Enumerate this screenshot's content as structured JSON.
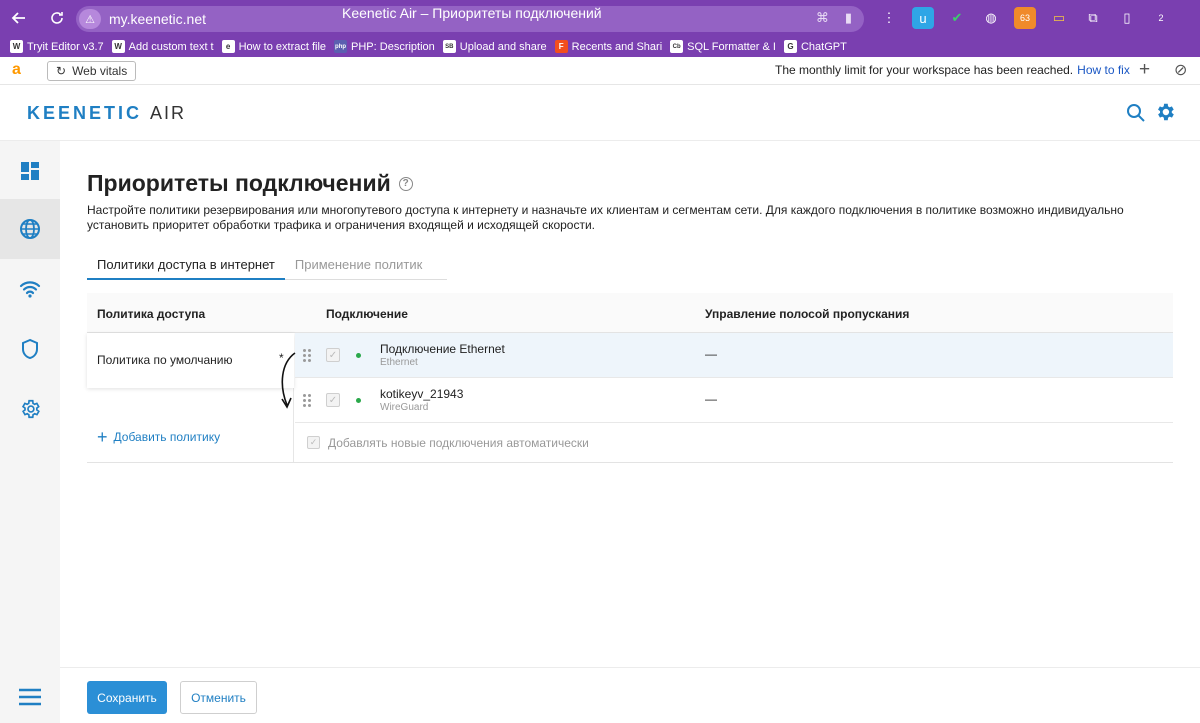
{
  "browser": {
    "url": "my.keenetic.net",
    "tab_title": "Keenetic Air – Приоритеты подключений",
    "back_icon": "arrow-left-icon",
    "reload_icon": "reload-icon",
    "ext_badges": {
      "calendar_count": "63",
      "downloads_count": "2"
    },
    "bookmarks": [
      {
        "label": "Tryit Editor v3.7",
        "icon": "W"
      },
      {
        "label": "Add custom text t",
        "icon": "W"
      },
      {
        "label": "How to extract file",
        "icon": "e"
      },
      {
        "label": "PHP: Description",
        "icon": "php"
      },
      {
        "label": "Upload and share",
        "icon": "SB"
      },
      {
        "label": "Recents and Shari",
        "icon": "F"
      },
      {
        "label": "SQL Formatter & I",
        "icon": "Cb"
      },
      {
        "label": "ChatGPT",
        "icon": "G"
      }
    ]
  },
  "notice_bar": {
    "web_vitals_label": "Web vitals",
    "message": "The monthly limit for your workspace has been reached.",
    "link": "How to fix"
  },
  "header": {
    "logo_main": "KEENETIC",
    "logo_model": "AIR"
  },
  "page": {
    "title": "Приоритеты подключений",
    "description": "Настройте политики резервирования или многопутевого доступа к интернету и назначьте их клиентам и сегментам сети. Для каждого подключения в политике возможно индивидуально установить приоритет обработки трафика и ограничения входящей и исходящей скорости.",
    "tabs": [
      {
        "label": "Политики доступа в интернет",
        "active": true
      },
      {
        "label": "Применение политик",
        "active": false
      }
    ],
    "columns": {
      "policy": "Политика доступа",
      "connection": "Подключение",
      "bandwidth": "Управление полосой пропускания"
    },
    "policy": {
      "name": "Политика по умолчанию",
      "marker": "*"
    },
    "add_policy": "Добавить политику",
    "connections": [
      {
        "name": "Подключение Ethernet",
        "type": "Ethernet",
        "bandwidth": "—",
        "status_color": "#2aa84a"
      },
      {
        "name": "kotikeyv_21943",
        "type": "WireGuard",
        "bandwidth": "—",
        "status_color": "#2aa84a"
      }
    ],
    "auto_add_label": "Добавлять новые подключения автоматически"
  },
  "footer": {
    "save": "Сохранить",
    "cancel": "Отменить"
  },
  "colors": {
    "accent": "#1f7fc3",
    "browser_chrome": "#7a3fb0",
    "save_button": "#2b8fd6"
  }
}
